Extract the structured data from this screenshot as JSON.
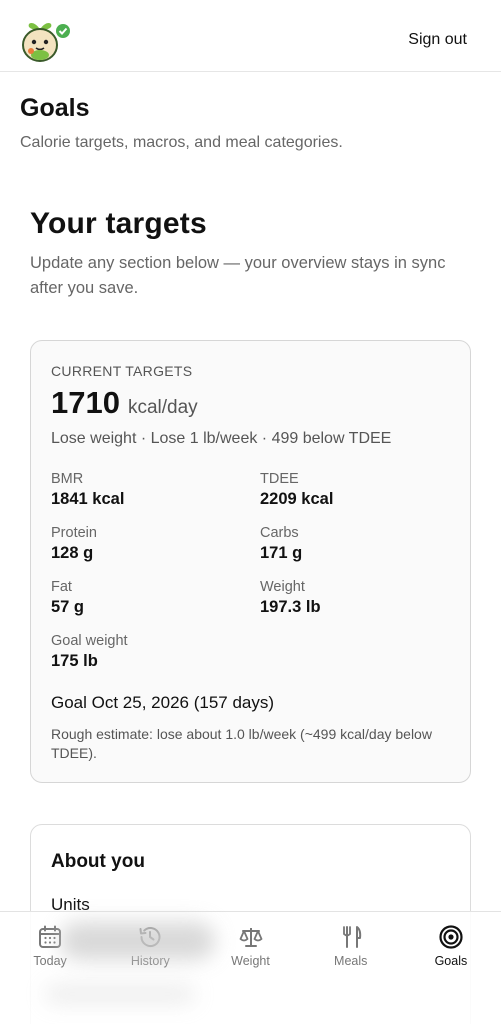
{
  "header": {
    "signout_label": "Sign out"
  },
  "page": {
    "title": "Goals",
    "subtitle": "Calorie targets, macros, and meal categories."
  },
  "targets_section": {
    "title": "Your targets",
    "subtitle": "Update any section below — your overview stays in sync after you save."
  },
  "current_targets": {
    "label": "CURRENT TARGETS",
    "kcal": "1710",
    "kcal_unit": "kcal/day",
    "goal_line": "Lose weight · Lose 1 lb/week · 499 below TDEE",
    "stats": [
      {
        "label": "BMR",
        "value": "1841 kcal"
      },
      {
        "label": "TDEE",
        "value": "2209 kcal"
      },
      {
        "label": "Protein",
        "value": "128 g"
      },
      {
        "label": "Carbs",
        "value": "171 g"
      },
      {
        "label": "Fat",
        "value": "57 g"
      },
      {
        "label": "Weight",
        "value": "197.3 lb"
      },
      {
        "label": "Goal weight",
        "value": "175 lb"
      }
    ],
    "goal_date": "Goal Oct 25, 2026 (157 days)",
    "estimate": "Rough estimate: lose about 1.0 lb/week (~499 kcal/day below TDEE)."
  },
  "about": {
    "title": "About you",
    "units_label": "Units"
  },
  "tabs": [
    {
      "label": "Today",
      "icon": "calendar-icon",
      "active": false
    },
    {
      "label": "History",
      "icon": "history-icon",
      "active": false
    },
    {
      "label": "Weight",
      "icon": "scale-icon",
      "active": false
    },
    {
      "label": "Meals",
      "icon": "fork-knife-icon",
      "active": false
    },
    {
      "label": "Goals",
      "icon": "target-icon",
      "active": true
    }
  ],
  "colors": {
    "logo_green": "#7cc043",
    "logo_body": "#f3e3c0",
    "check_green": "#4caf50",
    "tab_inactive": "#777777",
    "tab_active": "#111111"
  }
}
